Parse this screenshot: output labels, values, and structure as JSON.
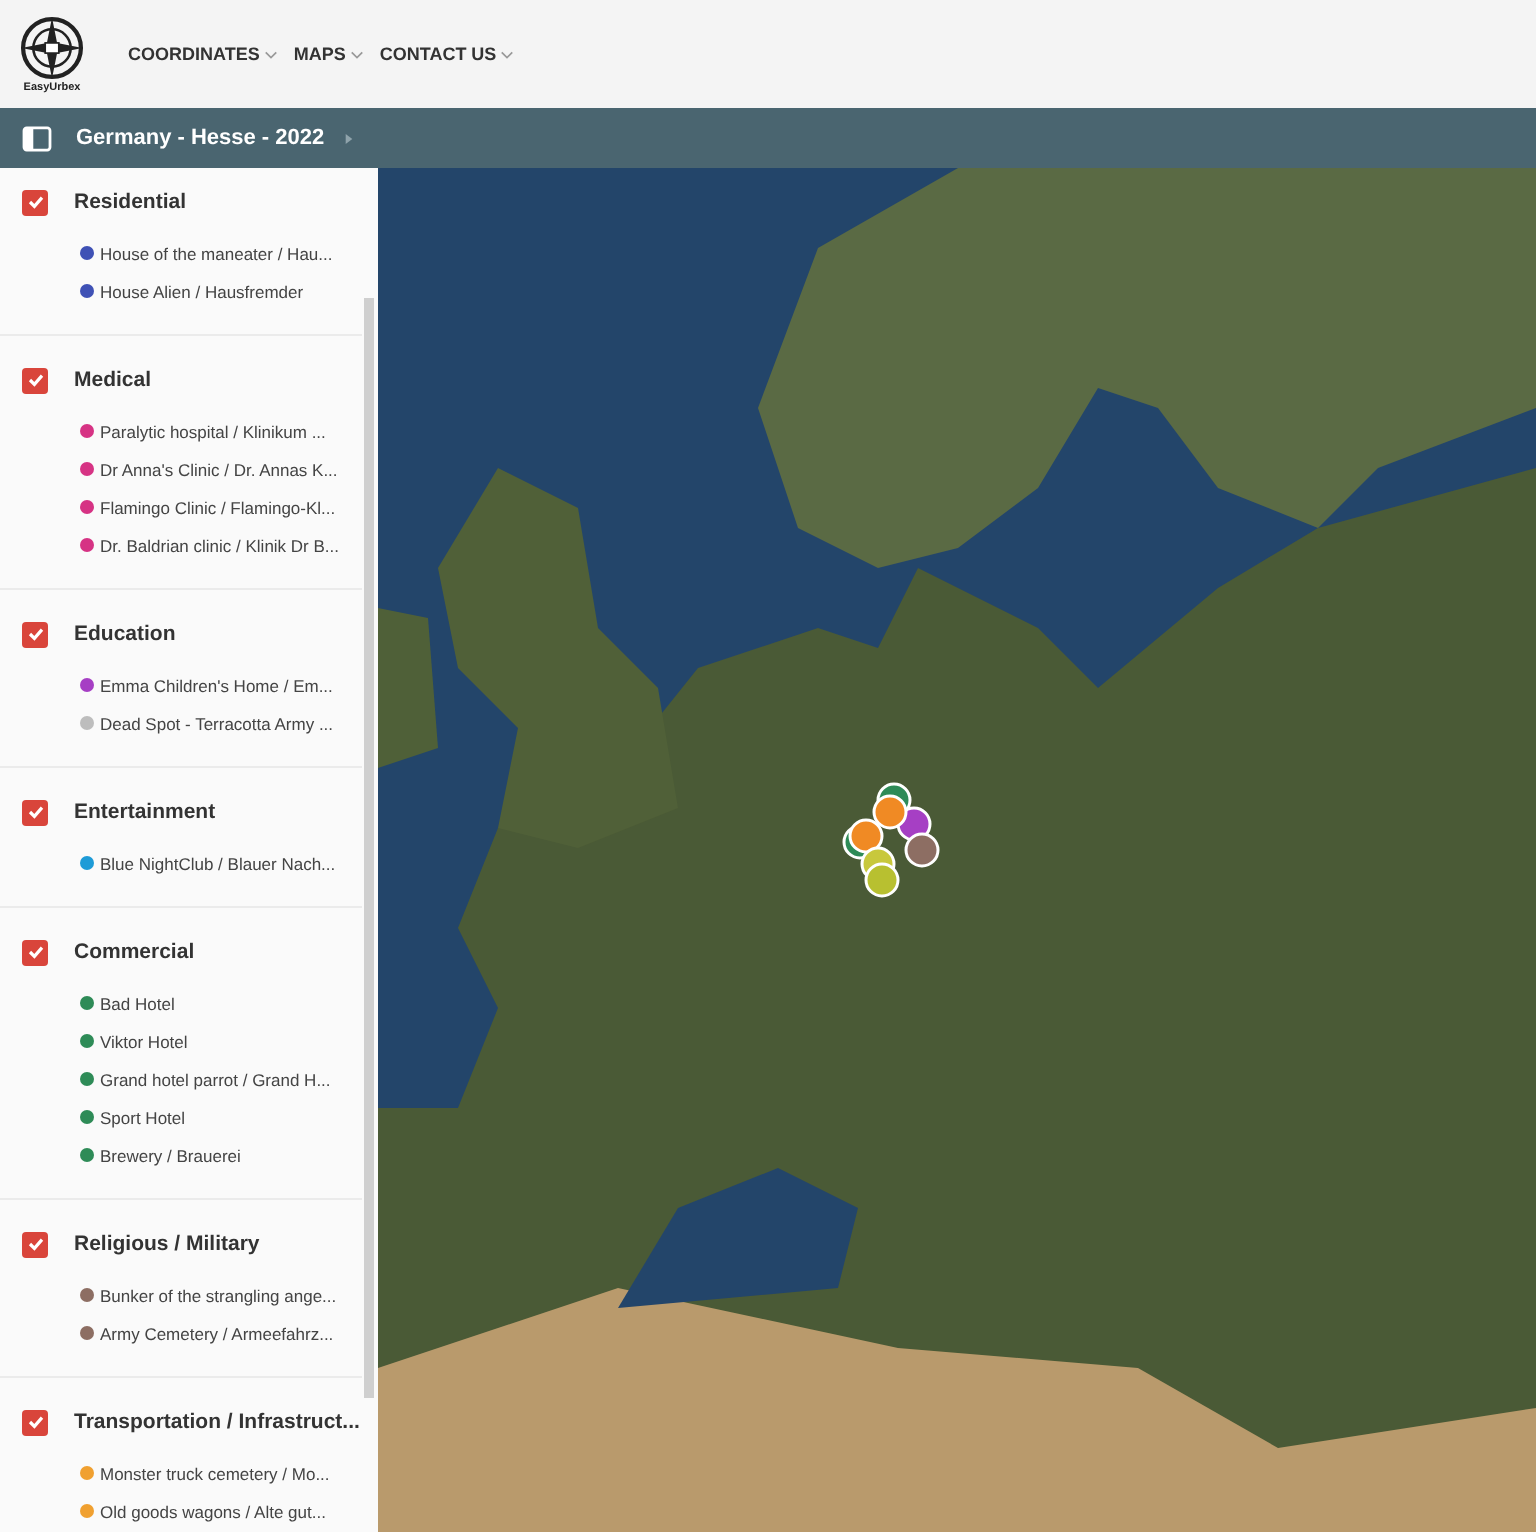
{
  "brand": {
    "name": "EasyUrbex"
  },
  "nav": [
    {
      "label": "COORDINATES"
    },
    {
      "label": "MAPS"
    },
    {
      "label": "CONTACT US"
    }
  ],
  "breadcrumb": {
    "title": "Germany - Hesse - 2022"
  },
  "categories": [
    {
      "name": "Residential",
      "checked": true,
      "items": [
        {
          "label": "House of the maneater / Hau...",
          "color": "#3f51b5"
        },
        {
          "label": "House Alien / Hausfremder",
          "color": "#3f51b5"
        }
      ]
    },
    {
      "name": "Medical",
      "checked": true,
      "items": [
        {
          "label": "Paralytic hospital / Klinikum ...",
          "color": "#d63384"
        },
        {
          "label": "Dr Anna's Clinic / Dr. Annas K...",
          "color": "#d63384"
        },
        {
          "label": "Flamingo Clinic / Flamingo-Kl...",
          "color": "#d63384"
        },
        {
          "label": "Dr. Baldrian clinic / Klinik Dr B...",
          "color": "#d63384"
        }
      ]
    },
    {
      "name": "Education",
      "checked": true,
      "items": [
        {
          "label": "Emma Children's Home / Em...",
          "color": "#a63fc4"
        },
        {
          "label": "Dead Spot - Terracotta Army ...",
          "color": "#bdbdbd"
        }
      ]
    },
    {
      "name": "Entertainment",
      "checked": true,
      "items": [
        {
          "label": "Blue NightClub / Blauer Nach...",
          "color": "#1e9bd7"
        }
      ]
    },
    {
      "name": "Commercial",
      "checked": true,
      "items": [
        {
          "label": "Bad Hotel",
          "color": "#2e8b57"
        },
        {
          "label": "Viktor Hotel",
          "color": "#2e8b57"
        },
        {
          "label": "Grand hotel parrot / Grand H...",
          "color": "#2e8b57"
        },
        {
          "label": "Sport Hotel",
          "color": "#2e8b57"
        },
        {
          "label": "Brewery / Brauerei",
          "color": "#2e8b57"
        }
      ]
    },
    {
      "name": "Religious / Military",
      "checked": true,
      "items": [
        {
          "label": "Bunker of the strangling ange...",
          "color": "#8d6e63"
        },
        {
          "label": "Army Cemetery / Armeefahrz...",
          "color": "#8d6e63"
        }
      ]
    },
    {
      "name": "Transportation / Infrastruct...",
      "checked": true,
      "items": [
        {
          "label": "Monster truck cemetery / Mo...",
          "color": "#f0a030"
        },
        {
          "label": "Old goods wagons / Alte gut...",
          "color": "#f0a030"
        }
      ]
    }
  ]
}
